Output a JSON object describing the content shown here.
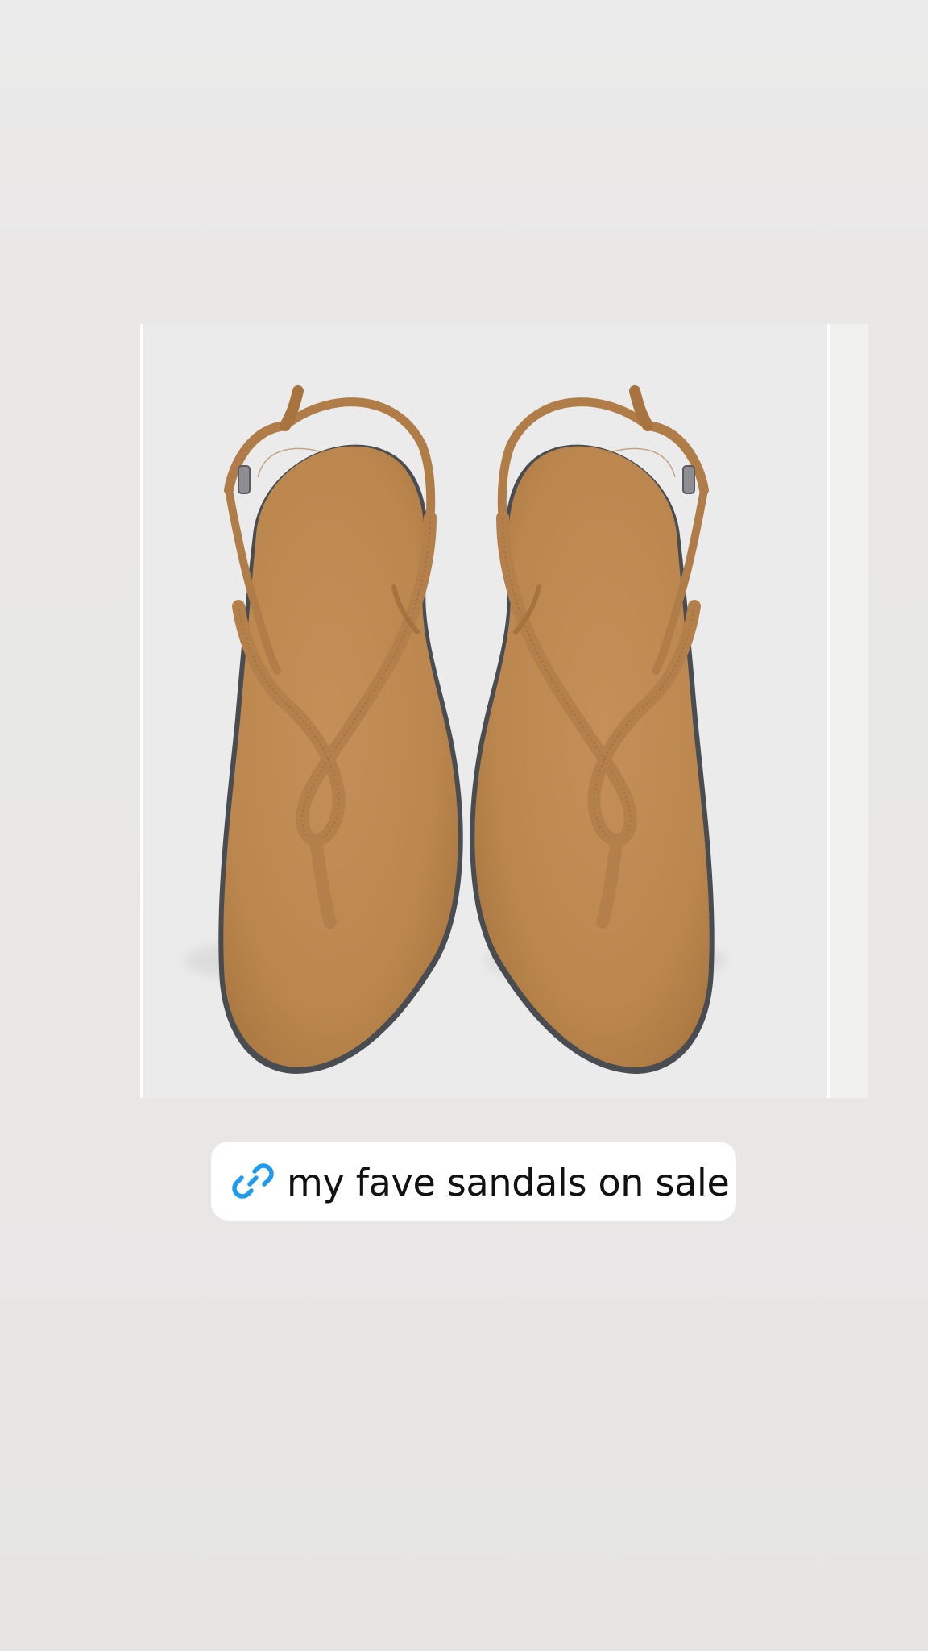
{
  "story": {
    "image_subject": "tan suede thong sandals",
    "link_sticker": {
      "icon": "link-icon",
      "label": "my fave sandals on sale",
      "icon_color": "#1d9bf0"
    }
  }
}
